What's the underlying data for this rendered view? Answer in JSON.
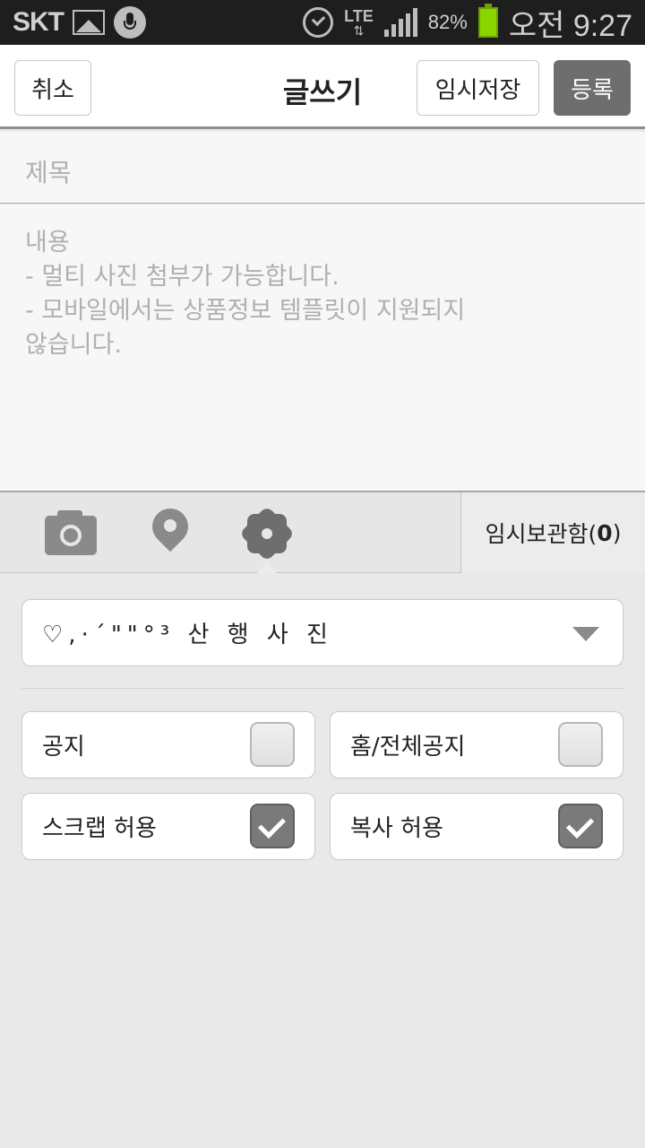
{
  "status_bar": {
    "carrier": "SKT",
    "lte": "LTE",
    "battery_pct": "82%",
    "time": "오전 9:27"
  },
  "header": {
    "cancel_label": "취소",
    "title": "글쓰기",
    "temp_save_label": "임시저장",
    "submit_label": "등록"
  },
  "form": {
    "title_placeholder": "제목",
    "content_placeholder": [
      "내용",
      "- 멀티 사진 첨부가 가능합니다.",
      "- 모바일에서는 상품정보 템플릿이 지원되지",
      "않습니다."
    ]
  },
  "toolbar": {
    "icons": [
      "camera-icon",
      "location-pin-icon",
      "settings-gear-icon"
    ],
    "drafts_label": "임시보관함(",
    "drafts_count": "0",
    "drafts_close": ")"
  },
  "settings": {
    "board_selected": "♡,·´\"\"°³ 산 행 사 진",
    "options": [
      {
        "label": "공지",
        "checked": false
      },
      {
        "label": "홈/전체공지",
        "checked": false
      },
      {
        "label": "스크랩 허용",
        "checked": true
      },
      {
        "label": "복사 허용",
        "checked": true
      }
    ]
  },
  "colors": {
    "submit_bg": "#6e6e6e",
    "battery": "#8bd400",
    "background": "#e9e9e9"
  }
}
